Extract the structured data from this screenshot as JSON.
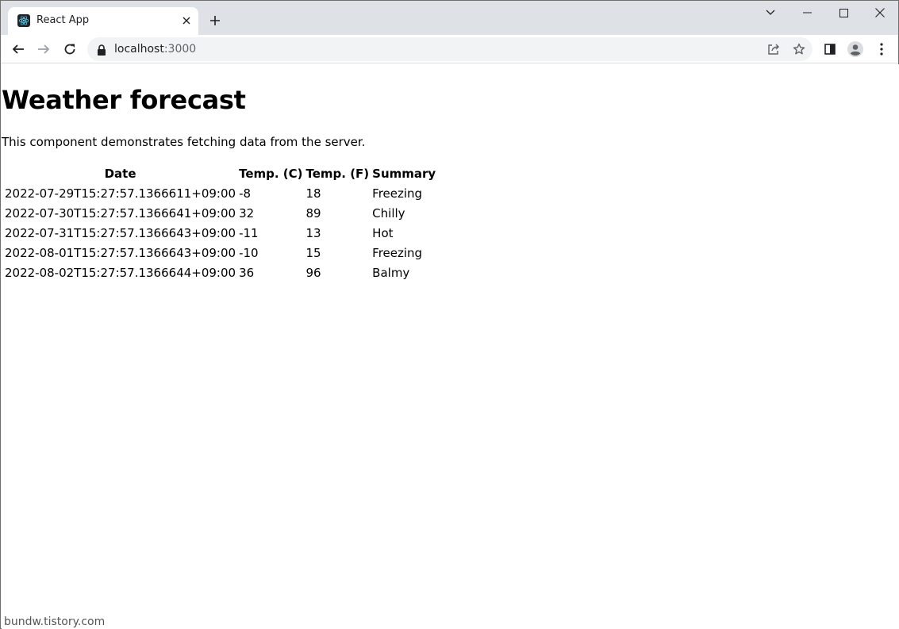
{
  "browser": {
    "tab_title": "React App",
    "url_host": "localhost",
    "url_port": ":3000"
  },
  "page": {
    "title": "Weather forecast",
    "description": "This component demonstrates fetching data from the server.",
    "table": {
      "headers": [
        "Date",
        "Temp. (C)",
        "Temp. (F)",
        "Summary"
      ],
      "rows": [
        [
          "2022-07-29T15:27:57.1366611+09:00",
          "-8",
          "18",
          "Freezing"
        ],
        [
          "2022-07-30T15:27:57.1366641+09:00",
          "32",
          "89",
          "Chilly"
        ],
        [
          "2022-07-31T15:27:57.1366643+09:00",
          "-11",
          "13",
          "Hot"
        ],
        [
          "2022-08-01T15:27:57.1366643+09:00",
          "-10",
          "15",
          "Freezing"
        ],
        [
          "2022-08-02T15:27:57.1366644+09:00",
          "36",
          "96",
          "Balmy"
        ]
      ]
    }
  },
  "watermark": "bundw.tistory.com",
  "colors": {
    "tabstrip": "#dee1e6",
    "omnibox": "#f1f3f4",
    "favicon_bg": "#20232a",
    "react_logo": "#61dafb"
  }
}
